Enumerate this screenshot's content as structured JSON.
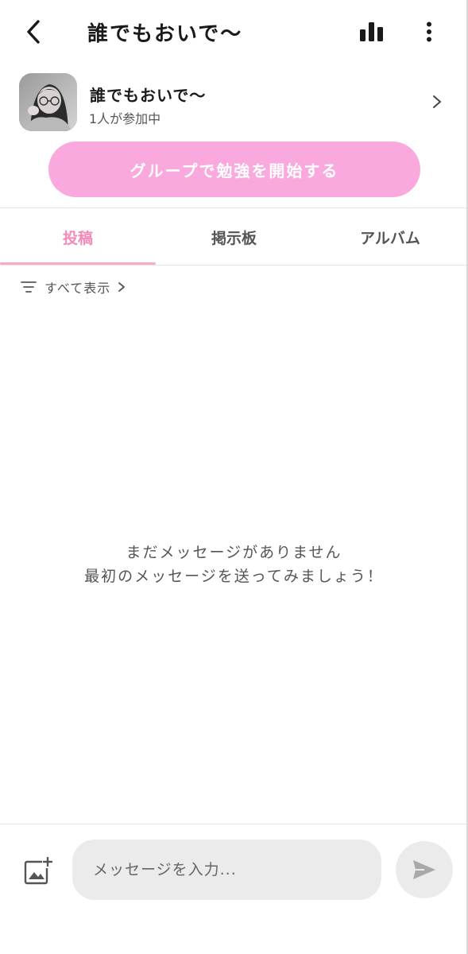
{
  "header": {
    "title": "誰でもおいで〜",
    "back_icon": "chevron-left-icon",
    "stats_icon": "bar-chart-icon",
    "more_icon": "more-vertical-icon"
  },
  "group": {
    "name": "誰でもおいで〜",
    "members": "1人が参加中",
    "chevron_icon": "chevron-right-icon"
  },
  "start_button": {
    "label": "グループで勉強を開始する",
    "color": "#f9a9dd"
  },
  "tabs": [
    {
      "label": "投稿",
      "active": true
    },
    {
      "label": "掲示板",
      "active": false
    },
    {
      "label": "アルバム",
      "active": false
    }
  ],
  "filter": {
    "label": "すべて表示",
    "icon": "filter-icon"
  },
  "empty_state": {
    "line1": "まだメッセージがありません",
    "line2": "最初のメッセージを送ってみましょう！"
  },
  "composer": {
    "placeholder": "メッセージを入力...",
    "image_icon": "add-image-icon",
    "send_icon": "send-icon"
  },
  "colors": {
    "accent_pink": "#f38ab9",
    "button_pink": "#f9a9dd",
    "input_bg": "#ebebeb"
  }
}
